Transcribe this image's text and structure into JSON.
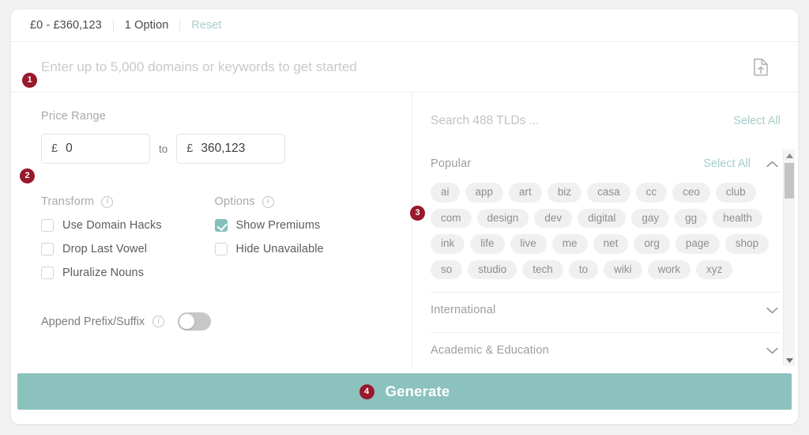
{
  "colors": {
    "accent_teal": "#8cc2bd",
    "badge_red": "#98182c",
    "chip_bg": "#f0f0f0",
    "link_teal": "#a4cdc9",
    "page_bg": "#f1f1f1"
  },
  "summary_bar": {
    "price_summary": "£0 - £360,123",
    "options_count": "1 Option",
    "reset_label": "Reset"
  },
  "keyword_search": {
    "badge": "1",
    "placeholder": "Enter up to 5,000 domains or keywords to get started",
    "value": "",
    "upload_icon": "file-upload-icon"
  },
  "price_range": {
    "badge": "2",
    "label": "Price Range",
    "currency_symbol": "£",
    "min_value": "0",
    "separator_label": "to",
    "max_value": "360,123"
  },
  "transform": {
    "label": "Transform",
    "info_icon": "info-icon",
    "items": [
      {
        "label": "Use Domain Hacks",
        "checked": false
      },
      {
        "label": "Drop Last Vowel",
        "checked": false
      },
      {
        "label": "Pluralize Nouns",
        "checked": false
      }
    ]
  },
  "options": {
    "label": "Options",
    "info_icon": "info-icon",
    "items": [
      {
        "label": "Show Premiums",
        "checked": true
      },
      {
        "label": "Hide Unavailable",
        "checked": false
      }
    ]
  },
  "append": {
    "label": "Append Prefix/Suffix",
    "info_icon": "info-icon",
    "toggle_on": false
  },
  "tld_panel": {
    "search_placeholder": "Search 488 TLDs ...",
    "search_value": "",
    "select_all_label": "Select All",
    "groups": [
      {
        "title": "Popular",
        "select_all_label": "Select All",
        "expanded": true,
        "chevron": "chevron-up-icon",
        "badge": "3",
        "chips": [
          "ai",
          "app",
          "art",
          "biz",
          "casa",
          "cc",
          "ceo",
          "club",
          "com",
          "design",
          "dev",
          "digital",
          "gay",
          "gg",
          "health",
          "ink",
          "life",
          "live",
          "me",
          "net",
          "org",
          "page",
          "shop",
          "so",
          "studio",
          "tech",
          "to",
          "wiki",
          "work",
          "xyz"
        ]
      },
      {
        "title": "International",
        "expanded": false,
        "chevron": "chevron-down-icon"
      },
      {
        "title": "Academic & Education",
        "expanded": false,
        "chevron": "chevron-down-icon"
      }
    ],
    "scrollbar": {
      "up_arrow": "scroll-up-arrow-icon",
      "down_arrow": "scroll-down-arrow-icon"
    }
  },
  "generate": {
    "badge": "4",
    "label": "Generate"
  }
}
